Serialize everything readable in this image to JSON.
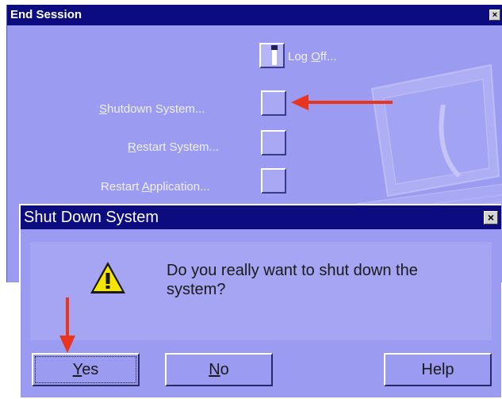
{
  "end_session": {
    "title": "End Session",
    "close_glyph": "×",
    "options": [
      {
        "underline": "",
        "pre": "",
        "rest": "Log ",
        "mnemonic_text": "O",
        "tail": "ff...",
        "icon": "log-off-icon"
      },
      {
        "pre": "",
        "mnemonic_text": "S",
        "tail": "hutdown System..."
      },
      {
        "pre": "",
        "mnemonic_text": "R",
        "tail": "estart System..."
      },
      {
        "pre": "Restart ",
        "mnemonic_text": "A",
        "tail": "pplication..."
      }
    ]
  },
  "shutdown_dialog": {
    "title": "Shut Down System",
    "close_glyph": "×",
    "message": "Do you really want to shut down the system?",
    "icon": "warning-icon",
    "buttons": {
      "yes": {
        "mnemonic_text": "Y",
        "tail": "es"
      },
      "no": {
        "mnemonic_text": "N",
        "tail": "o"
      },
      "help": {
        "label": "Help"
      }
    }
  },
  "colors": {
    "titlebar": "#0c0c80",
    "window_bg": "#9b9bf2",
    "annotation_arrow": "#e8361e"
  }
}
